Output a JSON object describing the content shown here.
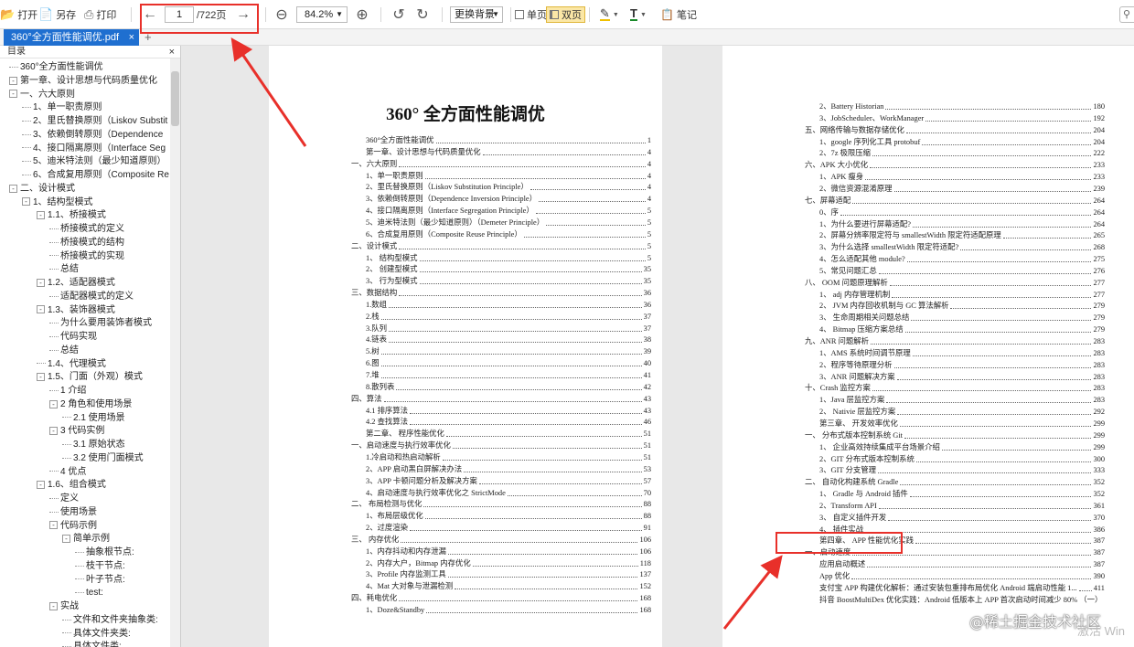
{
  "toolbar": {
    "open": "打开",
    "saveas": "另存",
    "print": "打印",
    "page_current": "1",
    "page_total": "/722页",
    "zoom": "84.2%",
    "background": "更换背景",
    "single": "单页",
    "double": "双页",
    "note": "笔记"
  },
  "tab": {
    "filename": "360°全方面性能调优.pdf",
    "close": "×",
    "new": "+"
  },
  "sidebar": {
    "title": "目录",
    "close": "×",
    "items": [
      {
        "label": "360°全方面性能调优",
        "lvl": 0,
        "exp": ""
      },
      {
        "label": "第一章、设计思想与代码质量优化",
        "lvl": 0,
        "exp": "-"
      },
      {
        "label": "一、六大原则",
        "lvl": 1,
        "exp": "-"
      },
      {
        "label": "1、单一职责原则",
        "lvl": 2,
        "exp": ""
      },
      {
        "label": "2、里氏替换原则（Liskov Substit",
        "lvl": 2,
        "exp": ""
      },
      {
        "label": "3、依赖倒转原则（Dependence",
        "lvl": 2,
        "exp": ""
      },
      {
        "label": "4、接口隔离原则（Interface Seg",
        "lvl": 2,
        "exp": ""
      },
      {
        "label": "5、迪米特法则（最少知道原则）",
        "lvl": 2,
        "exp": ""
      },
      {
        "label": "6、合成复用原则（Composite Re",
        "lvl": 2,
        "exp": ""
      },
      {
        "label": "二、设计模式",
        "lvl": 1,
        "exp": "-"
      },
      {
        "label": "1、结构型模式",
        "lvl": 2,
        "exp": "-"
      },
      {
        "label": "1.1、桥接模式",
        "lvl": 3,
        "exp": "-"
      },
      {
        "label": "桥接模式的定义",
        "lvl": 4,
        "exp": ""
      },
      {
        "label": "桥接模式的结构",
        "lvl": 4,
        "exp": ""
      },
      {
        "label": "桥接模式的实现",
        "lvl": 4,
        "exp": ""
      },
      {
        "label": "总结",
        "lvl": 4,
        "exp": ""
      },
      {
        "label": "1.2、适配器模式",
        "lvl": 3,
        "exp": "-"
      },
      {
        "label": "适配器模式的定义",
        "lvl": 4,
        "exp": ""
      },
      {
        "label": "1.3、装饰器模式",
        "lvl": 3,
        "exp": "-"
      },
      {
        "label": "为什么要用装饰者模式",
        "lvl": 4,
        "exp": ""
      },
      {
        "label": "代码实现",
        "lvl": 4,
        "exp": ""
      },
      {
        "label": "总结",
        "lvl": 4,
        "exp": ""
      },
      {
        "label": "1.4、代理模式",
        "lvl": 3,
        "exp": ""
      },
      {
        "label": "1.5、门面（外观）模式",
        "lvl": 3,
        "exp": "-"
      },
      {
        "label": "1 介绍",
        "lvl": 4,
        "exp": ""
      },
      {
        "label": "2 角色和使用场景",
        "lvl": 4,
        "exp": "-"
      },
      {
        "label": "2.1 使用场景",
        "lvl": 5,
        "exp": ""
      },
      {
        "label": "3 代码实例",
        "lvl": 4,
        "exp": "-"
      },
      {
        "label": "3.1 原始状态",
        "lvl": 5,
        "exp": ""
      },
      {
        "label": "3.2 使用门面模式",
        "lvl": 5,
        "exp": ""
      },
      {
        "label": "4 优点",
        "lvl": 4,
        "exp": ""
      },
      {
        "label": "1.6、组合模式",
        "lvl": 3,
        "exp": "-"
      },
      {
        "label": "定义",
        "lvl": 4,
        "exp": ""
      },
      {
        "label": "使用场景",
        "lvl": 4,
        "exp": ""
      },
      {
        "label": "代码示例",
        "lvl": 4,
        "exp": "-"
      },
      {
        "label": "简单示例",
        "lvl": 5,
        "exp": "-"
      },
      {
        "label": "抽象根节点:",
        "lvl": 6,
        "exp": ""
      },
      {
        "label": "枝干节点:",
        "lvl": 6,
        "exp": ""
      },
      {
        "label": "叶子节点:",
        "lvl": 6,
        "exp": ""
      },
      {
        "label": "test:",
        "lvl": 6,
        "exp": ""
      },
      {
        "label": "实战",
        "lvl": 4,
        "exp": "-"
      },
      {
        "label": "文件和文件夹抽象类:",
        "lvl": 5,
        "exp": ""
      },
      {
        "label": "具体文件夹类:",
        "lvl": 5,
        "exp": ""
      },
      {
        "label": "具体文件类:",
        "lvl": 5,
        "exp": ""
      }
    ]
  },
  "page1": {
    "title": "360° 全方面性能调优",
    "entries": [
      {
        "t": "360°全方面性能调优",
        "n": "1",
        "i": 0
      },
      {
        "t": "第一章、设计思想与代码质量优化",
        "n": "4",
        "i": 0
      },
      {
        "t": "一、六大原则",
        "n": "4",
        "i": 1
      },
      {
        "t": "1、单一职责原则",
        "n": "4",
        "i": 2
      },
      {
        "t": "2、里氏替换原则（Liskov Substitution Principle）",
        "n": "4",
        "i": 2
      },
      {
        "t": "3、依赖倒转原则（Dependence Inversion Principle）",
        "n": "4",
        "i": 2
      },
      {
        "t": "4、接口隔离原则（Interface Segregation Principle）",
        "n": "5",
        "i": 2
      },
      {
        "t": "5、迪米特法则（最少知道原则）（Demeter Principle）",
        "n": "5",
        "i": 2
      },
      {
        "t": "6、合成复用原则（Composite Reuse Principle）",
        "n": "5",
        "i": 2
      },
      {
        "t": "二、设计模式",
        "n": "5",
        "i": 1
      },
      {
        "t": "1、 结构型模式",
        "n": "5",
        "i": 2
      },
      {
        "t": "2、 创建型模式",
        "n": "35",
        "i": 2
      },
      {
        "t": "3、 行为型模式",
        "n": "35",
        "i": 2
      },
      {
        "t": "三、数据结构",
        "n": "36",
        "i": 1
      },
      {
        "t": "1.数组",
        "n": "36",
        "i": 2
      },
      {
        "t": "2.栈",
        "n": "37",
        "i": 2
      },
      {
        "t": "3.队列",
        "n": "37",
        "i": 2
      },
      {
        "t": "4.链表",
        "n": "38",
        "i": 2
      },
      {
        "t": "5.树",
        "n": "39",
        "i": 2
      },
      {
        "t": "6.图",
        "n": "40",
        "i": 2
      },
      {
        "t": "7.堆",
        "n": "41",
        "i": 2
      },
      {
        "t": "8.散列表",
        "n": "42",
        "i": 2
      },
      {
        "t": "四、算法",
        "n": "43",
        "i": 1
      },
      {
        "t": "4.1 排序算法",
        "n": "43",
        "i": 2
      },
      {
        "t": "4.2 查找算法",
        "n": "46",
        "i": 2
      },
      {
        "t": "第二章、 程序性能优化",
        "n": "51",
        "i": 0
      },
      {
        "t": "一、启动速度与执行效率优化",
        "n": "51",
        "i": 1
      },
      {
        "t": "1.冷启动和热启动解析",
        "n": "51",
        "i": 2
      },
      {
        "t": "2、APP 启动黑白屏解决办法",
        "n": "53",
        "i": 2
      },
      {
        "t": "3、APP 卡顿问题分析及解决方案",
        "n": "57",
        "i": 2
      },
      {
        "t": "4、启动速度与执行效率优化之 StrictMode",
        "n": "70",
        "i": 2
      },
      {
        "t": "二、 布局检测与优化",
        "n": "88",
        "i": 1
      },
      {
        "t": "1、布局层级优化",
        "n": "88",
        "i": 2
      },
      {
        "t": "2、过度渲染",
        "n": "91",
        "i": 2
      },
      {
        "t": "三、 内存优化",
        "n": "106",
        "i": 1
      },
      {
        "t": "1、内存抖动和内存泄漏",
        "n": "106",
        "i": 2
      },
      {
        "t": "2、内存大户，Bitmap 内存优化",
        "n": "118",
        "i": 2
      },
      {
        "t": "3、Profile 内存监测工具",
        "n": "137",
        "i": 2
      },
      {
        "t": "4、Mat 大对象与泄漏检测",
        "n": "152",
        "i": 2
      },
      {
        "t": "四、耗电优化",
        "n": "168",
        "i": 1
      },
      {
        "t": "1、Doze&Standby",
        "n": "168",
        "i": 2
      }
    ]
  },
  "page2": {
    "entries": [
      {
        "t": "2、Battery Historian",
        "n": "180",
        "i": 2
      },
      {
        "t": "3、JobScheduler、WorkManager",
        "n": "192",
        "i": 2
      },
      {
        "t": "五、网络传输与数据存储优化",
        "n": "204",
        "i": 1
      },
      {
        "t": "1、google 序列化工具 protobuf",
        "n": "204",
        "i": 2
      },
      {
        "t": "2、7z 极限压缩",
        "n": "222",
        "i": 2
      },
      {
        "t": "六、APK 大小优化",
        "n": "233",
        "i": 1
      },
      {
        "t": "1、APK 瘦身",
        "n": "233",
        "i": 2
      },
      {
        "t": "2、微信资源混淆原理",
        "n": "239",
        "i": 2
      },
      {
        "t": "七、屏幕适配",
        "n": "264",
        "i": 1
      },
      {
        "t": "0、序",
        "n": "264",
        "i": 2
      },
      {
        "t": "1、为什么要进行屏幕适配?",
        "n": "264",
        "i": 2
      },
      {
        "t": "2、屏幕分辨率限定符与 smallestWidth 限定符适配原理",
        "n": "265",
        "i": 2
      },
      {
        "t": "3、为什么选择 smallestWidth 限定符适配?",
        "n": "268",
        "i": 2
      },
      {
        "t": "4、怎么适配其他 module?",
        "n": "275",
        "i": 2
      },
      {
        "t": "5、常见问题汇总",
        "n": "276",
        "i": 2
      },
      {
        "t": "八、 OOM 问题原理解析",
        "n": "277",
        "i": 1
      },
      {
        "t": "1、 adj 内存管理机制",
        "n": "277",
        "i": 2
      },
      {
        "t": "2、 JVM 内存回收机制与 GC 算法解析",
        "n": "279",
        "i": 2
      },
      {
        "t": "3、 生命周期相关问题总结",
        "n": "279",
        "i": 2
      },
      {
        "t": "4、 Bitmap 压缩方案总结",
        "n": "279",
        "i": 2
      },
      {
        "t": "九、ANR 问题解析",
        "n": "283",
        "i": 1
      },
      {
        "t": "1、AMS 系统时间调节原理",
        "n": "283",
        "i": 2
      },
      {
        "t": "2、程序等待原理分析",
        "n": "283",
        "i": 2
      },
      {
        "t": "3、ANR 问题解决方案",
        "n": "283",
        "i": 2
      },
      {
        "t": "十、Crash 监控方案",
        "n": "283",
        "i": 1
      },
      {
        "t": "1、Java 层监控方案",
        "n": "283",
        "i": 2
      },
      {
        "t": "2、 Nativie 层监控方案",
        "n": "292",
        "i": 2
      },
      {
        "t": "第三章、 开发效率优化",
        "n": "299",
        "i": 0
      },
      {
        "t": "一、 分布式版本控制系统 Git",
        "n": "299",
        "i": 1
      },
      {
        "t": "1、 企业高效持续集成平台场景介绍",
        "n": "299",
        "i": 2
      },
      {
        "t": "2、GIT 分布式版本控制系统",
        "n": "300",
        "i": 2
      },
      {
        "t": "3、GIT 分支管理",
        "n": "333",
        "i": 2
      },
      {
        "t": "二、 自动化构建系统 Gradle",
        "n": "352",
        "i": 1
      },
      {
        "t": "1、 Gradle 与 Android 插件",
        "n": "352",
        "i": 2
      },
      {
        "t": "2、Transform API",
        "n": "361",
        "i": 2
      },
      {
        "t": "3、 自定义插件开发",
        "n": "370",
        "i": 2
      },
      {
        "t": "4、 插件实战",
        "n": "386",
        "i": 2
      },
      {
        "t": "第四章、 APP 性能优化实践",
        "n": "387",
        "i": 0
      },
      {
        "t": "一、启动速度",
        "n": "387",
        "i": 1
      },
      {
        "t": "应用启动概述",
        "n": "387",
        "i": 2
      },
      {
        "t": "App 优化",
        "n": "390",
        "i": 2
      },
      {
        "t": "支付宝 APP 构建优化解析：通过安装包重排布局优化 Android 端启动性能 1...",
        "n": "411",
        "i": 2
      },
      {
        "t": "抖音 BoostMultiDex 优化实践：Android 低版本上 APP 首次启动时间减少 80% （一）",
        "n": "",
        "i": 2
      }
    ]
  },
  "watermark": "@稀土掘金技术社区",
  "activate": "激活 Win"
}
